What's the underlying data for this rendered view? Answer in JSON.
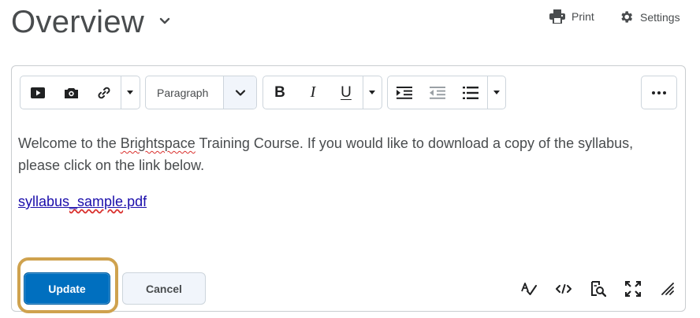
{
  "page": {
    "title": "Overview",
    "title_dropdown_icon": "chevron-down-icon"
  },
  "header_actions": {
    "print": {
      "label": "Print",
      "icon": "printer-icon"
    },
    "settings": {
      "label": "Settings",
      "icon": "gear-icon"
    }
  },
  "toolbar": {
    "insert_group": [
      {
        "name": "insert-stuff",
        "icon": "video-icon"
      },
      {
        "name": "insert-image",
        "icon": "camera-icon"
      },
      {
        "name": "insert-link",
        "icon": "link-icon"
      }
    ],
    "block_format": {
      "selected": "Paragraph",
      "icon": "chevron-down-icon"
    },
    "format_group": [
      {
        "name": "bold",
        "label": "B"
      },
      {
        "name": "italic",
        "label": "I"
      },
      {
        "name": "underline",
        "label": "U"
      }
    ],
    "list_group": [
      {
        "name": "indent",
        "icon": "indent-icon"
      },
      {
        "name": "outdent",
        "icon": "outdent-icon"
      },
      {
        "name": "bulleted-list",
        "icon": "bullet-list-icon"
      }
    ],
    "more": {
      "icon": "more-horizontal-icon"
    }
  },
  "content": {
    "p1_a": "Welcome to the ",
    "p1_spell": "Brightspace",
    "p1_b": " Training Course.  If you would like to download a copy of the syllabus, please click on the link below.",
    "link_a": "syllabus",
    "link_spell": "_sample",
    "link_b": ".pdf"
  },
  "buttons": {
    "update": "Update",
    "cancel": "Cancel"
  },
  "footer_tools": [
    {
      "name": "spellcheck",
      "icon": "spellcheck-icon"
    },
    {
      "name": "source-code",
      "icon": "code-icon"
    },
    {
      "name": "preview",
      "icon": "preview-icon"
    },
    {
      "name": "fullscreen",
      "icon": "fullscreen-icon"
    },
    {
      "name": "resize",
      "icon": "resize-handle-icon"
    }
  ],
  "colors": {
    "primary_button": "#006fbf",
    "highlight_ring": "#cfa24e",
    "link": "#1a0dab",
    "spellcheck": "#d9302d"
  }
}
